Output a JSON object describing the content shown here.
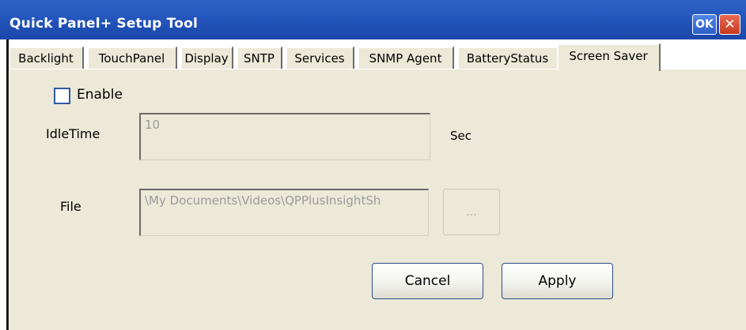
{
  "window": {
    "title": "Quick Panel+ Setup Tool",
    "ok_label": "OK",
    "close_label": "✕",
    "title_color": "#2556bd"
  },
  "tabs": [
    {
      "label": "Backlight"
    },
    {
      "label": "TouchPanel"
    },
    {
      "label": "Display"
    },
    {
      "label": "SNTP"
    },
    {
      "label": "Services"
    },
    {
      "label": "SNMP Agent"
    },
    {
      "label": "BatteryStatus"
    },
    {
      "label": "Screen Saver",
      "active": true
    }
  ],
  "form": {
    "enable_label": "Enable",
    "enable_checked": false,
    "idle_time_label": "IdleTime",
    "idle_time_value": "10",
    "idle_time_unit": "Sec",
    "file_label": "File",
    "file_value": "\\My Documents\\Videos\\QPPlusInsightSh",
    "browse_label": "..."
  },
  "buttons": {
    "cancel": "Cancel",
    "apply": "Apply"
  },
  "colors": {
    "panel_bg": "#ece9d8",
    "button_border": "#2a4c8f"
  }
}
